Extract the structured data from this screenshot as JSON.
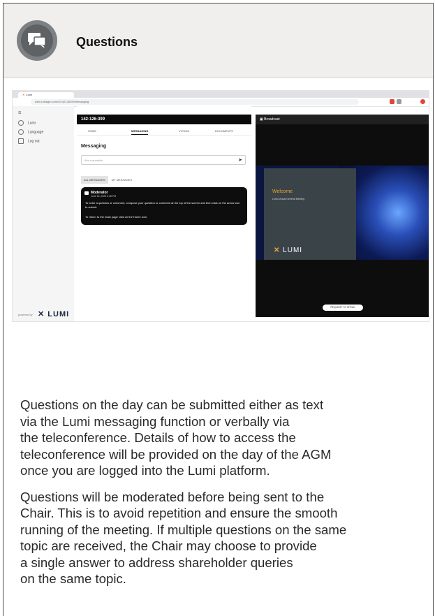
{
  "header": {
    "title": "Questions",
    "icon": "chat-bubbles-icon"
  },
  "screenshot": {
    "browser_tab": "Lumi",
    "address": "web.lumiagm.com/#/142126399/messaging",
    "sidebar": {
      "items": [
        "Lumi",
        "Language",
        "Log out"
      ],
      "powered_by": "powered by",
      "logo": "LUMI"
    },
    "meeting_id": "142-126-399",
    "tabs": [
      "HOME",
      "MESSAGING",
      "VOTING",
      "DOCUMENTS"
    ],
    "messaging_title": "Messaging",
    "ask_placeholder": "Ask a question",
    "filters": [
      "ALL MESSAGES",
      "MY MESSAGES"
    ],
    "moderator": {
      "name": "Moderator",
      "time": "June 16, 2023 3:48 PM",
      "line1": "To enter a question or comment, compose your question or comment at the top of the screen and then click on the arrow icon to submit.",
      "line2": "To return to the main page click on the Home icon."
    },
    "broadcast": {
      "label": "Broadcast",
      "welcome": "Welcome",
      "subtitle": "Lumi Annual General Meeting",
      "logo": "LUMI",
      "request_button": "REQUEST TO SPEAK"
    }
  },
  "body": {
    "paragraph1": [
      "Questions on the day can be submitted either as text",
      "via the Lumi messaging function or verbally via",
      "the teleconference. Details of how to access the",
      "teleconference will be provided on the day of the AGM",
      "once you are logged into the Lumi platform."
    ],
    "paragraph2": [
      "Questions will be moderated before being sent to the",
      "Chair. This is to avoid repetition and ensure the smooth",
      "running of the meeting. If multiple questions on the same",
      "topic are received, the Chair may choose to provide",
      "a single answer to address shareholder queries",
      "on the same topic."
    ]
  },
  "colors": {
    "header_bg": "#f0efee",
    "accent": "#f2a33a"
  }
}
